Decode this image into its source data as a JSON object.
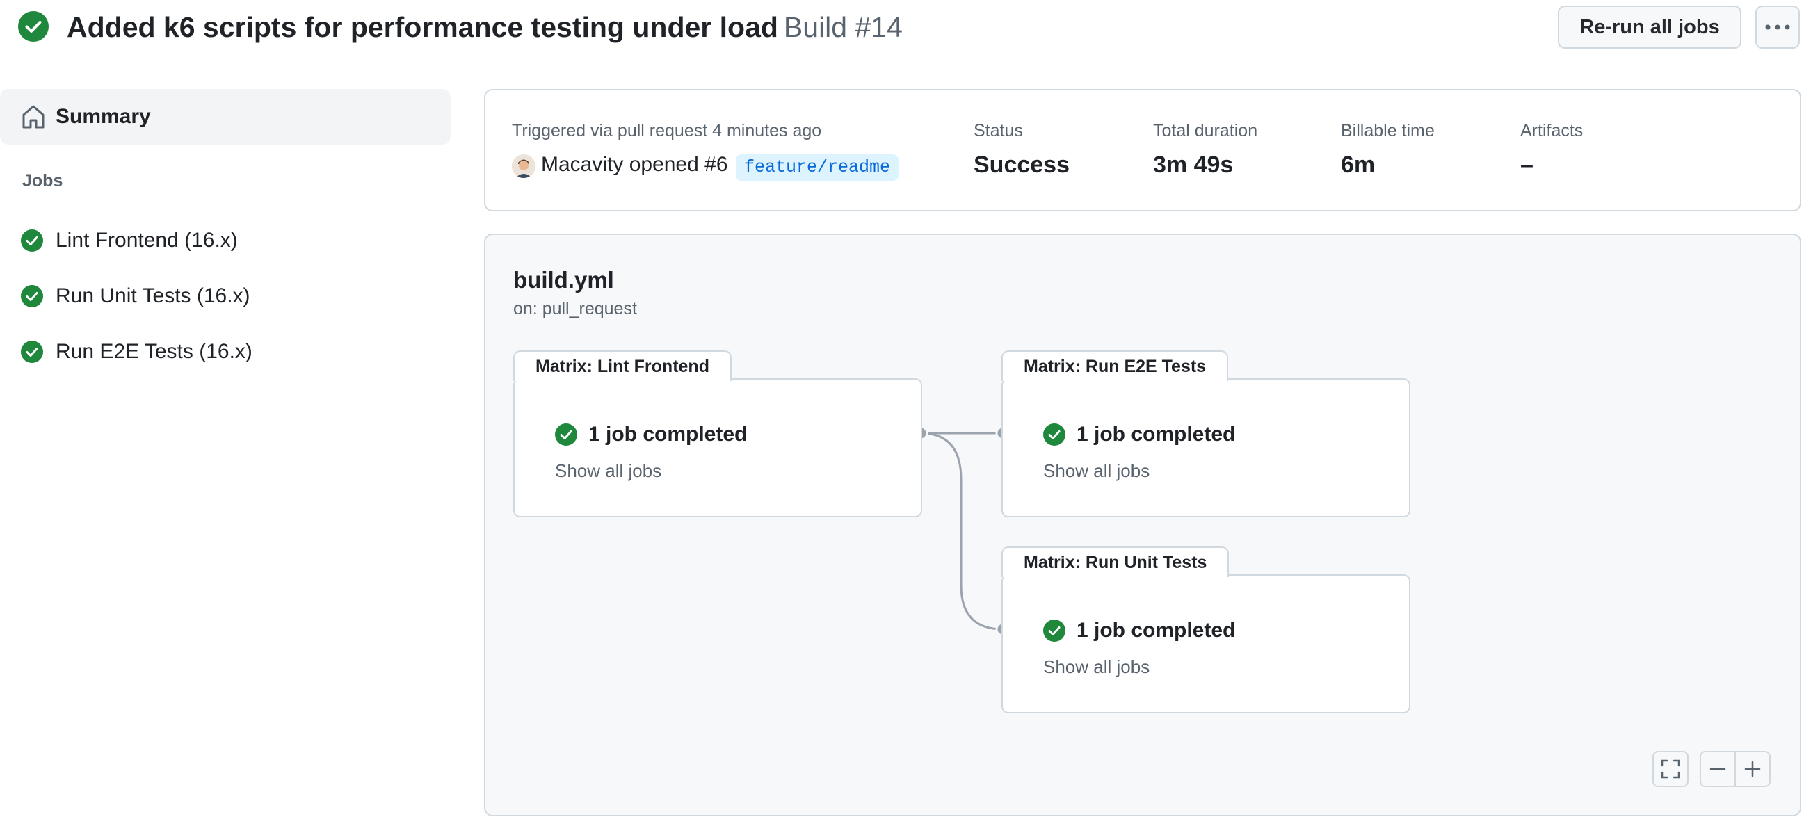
{
  "header": {
    "title": "Added k6 scripts for performance testing under load",
    "build": "Build #14",
    "rerun_label": "Re-run all jobs",
    "status_icon": "check-circle-fill-icon",
    "more_icon": "kebab-horizontal-icon"
  },
  "sidebar": {
    "summary_label": "Summary",
    "summary_icon": "home-icon",
    "jobs_heading": "Jobs",
    "jobs": [
      {
        "label": "Lint Frontend (16.x)",
        "status": "success"
      },
      {
        "label": "Run Unit Tests (16.x)",
        "status": "success"
      },
      {
        "label": "Run E2E Tests (16.x)",
        "status": "success"
      }
    ]
  },
  "summary": {
    "trigger_text": "Triggered via pull request 4 minutes ago",
    "actor_text": "Macavity opened #6",
    "branch": "feature/readme",
    "status_label": "Status",
    "status_value": "Success",
    "duration_label": "Total duration",
    "duration_value": "3m 49s",
    "billable_label": "Billable time",
    "billable_value": "6m",
    "artifacts_label": "Artifacts",
    "artifacts_value": "–"
  },
  "workflow": {
    "filename": "build.yml",
    "trigger": "on: pull_request",
    "nodes": [
      {
        "title": "Matrix: Lint Frontend",
        "status_text": "1 job completed",
        "link_text": "Show all jobs"
      },
      {
        "title": "Matrix: Run E2E Tests",
        "status_text": "1 job completed",
        "link_text": "Show all jobs"
      },
      {
        "title": "Matrix: Run Unit Tests",
        "status_text": "1 job completed",
        "link_text": "Show all jobs"
      }
    ],
    "controls": [
      "fullscreen-icon",
      "zoom-out-icon",
      "zoom-in-icon"
    ]
  },
  "colors": {
    "success": "#1f883d",
    "link": "#0969da",
    "branch_bg": "#ddf4ff",
    "border": "#d1d9e0",
    "panel_bg": "#f6f8fa",
    "muted": "#59636e"
  }
}
